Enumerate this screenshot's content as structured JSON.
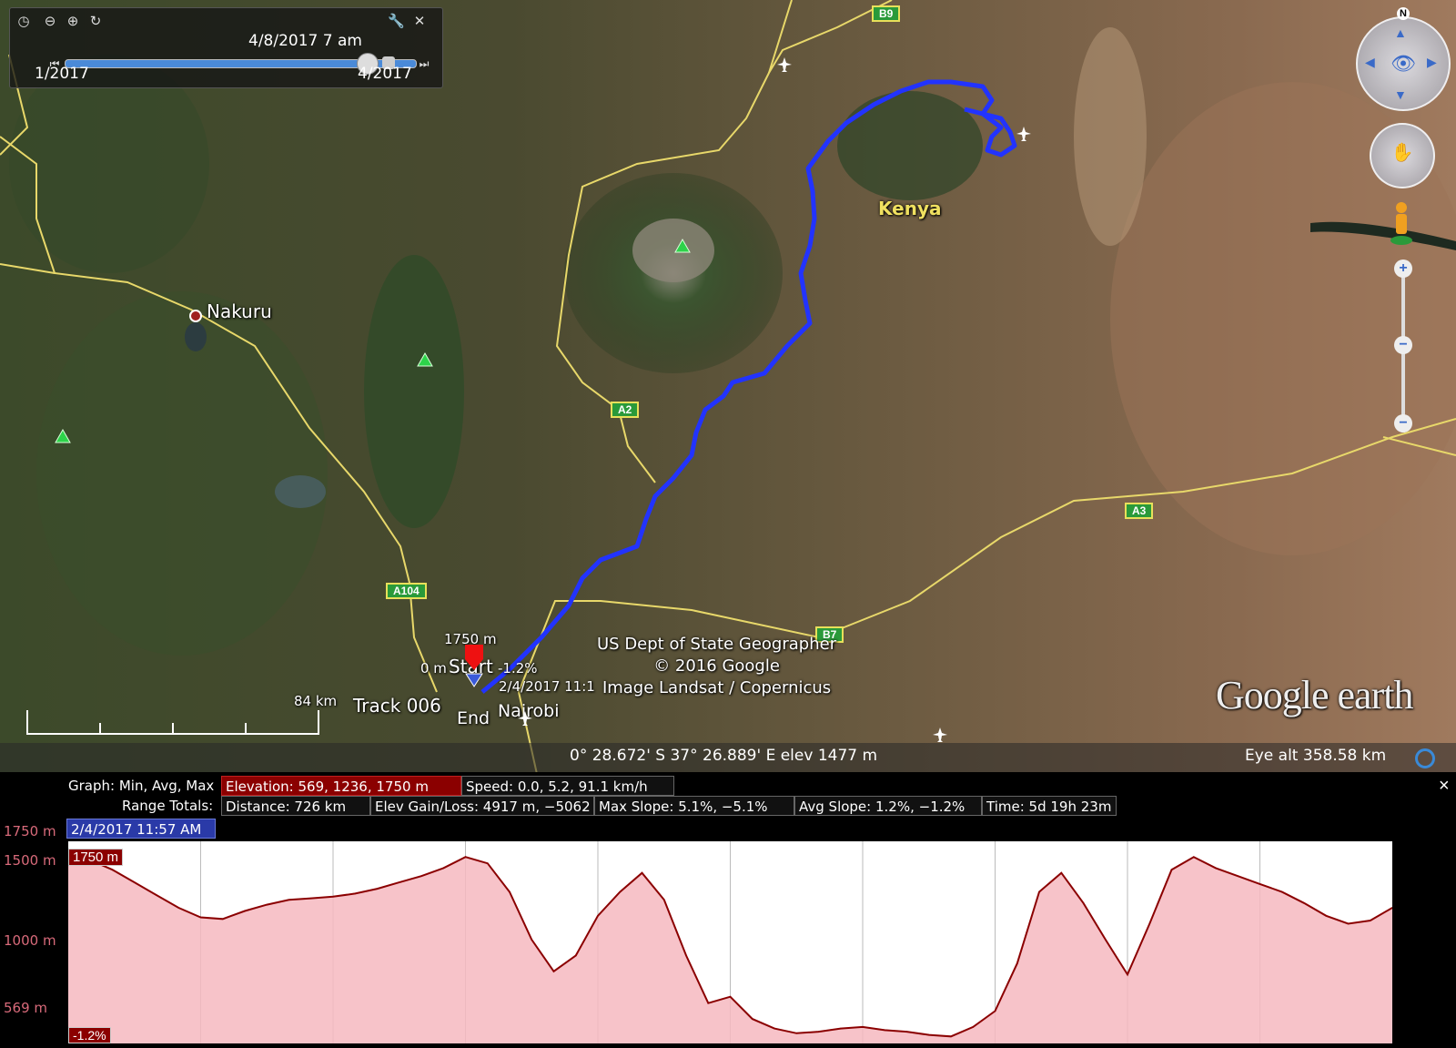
{
  "time_slider": {
    "current_time": "4/8/2017   7 am",
    "start_label": "1/2017",
    "end_label": "4/2017"
  },
  "map": {
    "places": {
      "nakuru": "Nakuru",
      "kenya": "Kenya",
      "nairobi": "Nairobi"
    },
    "roads": [
      "B9",
      "A2",
      "A104",
      "A3",
      "B7"
    ],
    "markers": {
      "start": "Start",
      "end": "End",
      "elevation_top": "1750 m",
      "elevation_zero": "0 m",
      "slope": "-1.2%",
      "track_name": "Track 006",
      "timestamp": "2/4/2017 11:1"
    },
    "scale_label": "84 km",
    "attribution": [
      "US Dept of State Geographer",
      "© 2016 Google",
      "Image Landsat / Copernicus"
    ],
    "logo": "Google earth",
    "compass_north": "N",
    "track_color": "#2233ff"
  },
  "status_bar": {
    "coordinates": "0° 28.672' S  37° 26.889' E elev  1477 m",
    "eye_alt": "Eye alt   358.58 km"
  },
  "graph": {
    "header_label": "Graph: Min, Avg, Max",
    "elevation": "Elevation: 569, 1236, 1750 m",
    "speed": "Speed: 0.0, 5.2, 91.1 km/h",
    "range_label": "Range Totals:",
    "distance": "Distance: 726 km",
    "elev_gain_loss": "Elev Gain/Loss: 4917 m, −5062 m",
    "max_slope": "Max Slope: 5.1%, −5.1%",
    "avg_slope": "Avg Slope: 1.2%, −1.2%",
    "time": "Time: 5d 19h 23m",
    "cursor_time": "2/4/2017 11:57 AM",
    "cursor_elev": "1750 m",
    "cursor_slope": "-1.2%",
    "close": "×",
    "elevation_color": "#8b0000",
    "fill_color": "#f6b8c0"
  },
  "chart_data": {
    "type": "area",
    "ylabel": "",
    "y_ticks": [
      "1750 m",
      "1500 m",
      "1000 m",
      "569 m"
    ],
    "ylim": [
      569,
      1750
    ],
    "x": [
      0,
      1,
      2,
      3,
      4,
      5,
      6,
      7,
      8,
      9,
      10,
      11,
      12,
      13,
      14,
      15,
      16,
      17,
      18,
      19,
      20,
      21,
      22,
      23,
      24,
      25,
      26,
      27,
      28,
      29,
      30,
      31,
      32,
      33,
      34,
      35,
      36,
      37,
      38,
      39,
      40,
      41,
      42,
      43,
      44,
      45,
      46,
      47,
      48,
      49,
      50,
      51,
      52,
      53,
      54,
      55,
      56,
      57,
      58,
      59,
      60
    ],
    "series": [
      {
        "values": [
          1750,
          1700,
          1640,
          1560,
          1480,
          1400,
          1340,
          1330,
          1380,
          1420,
          1450,
          1460,
          1470,
          1490,
          1520,
          1560,
          1600,
          1650,
          1720,
          1680,
          1500,
          1200,
          1000,
          1100,
          1350,
          1500,
          1620,
          1450,
          1100,
          800,
          840,
          700,
          640,
          610,
          620,
          640,
          650,
          630,
          620,
          600,
          590,
          650,
          750,
          1050,
          1500,
          1620,
          1430,
          1200,
          980,
          1300,
          1640,
          1720,
          1650,
          1600,
          1550,
          1500,
          1430,
          1350,
          1300,
          1320,
          1400
        ]
      }
    ]
  }
}
